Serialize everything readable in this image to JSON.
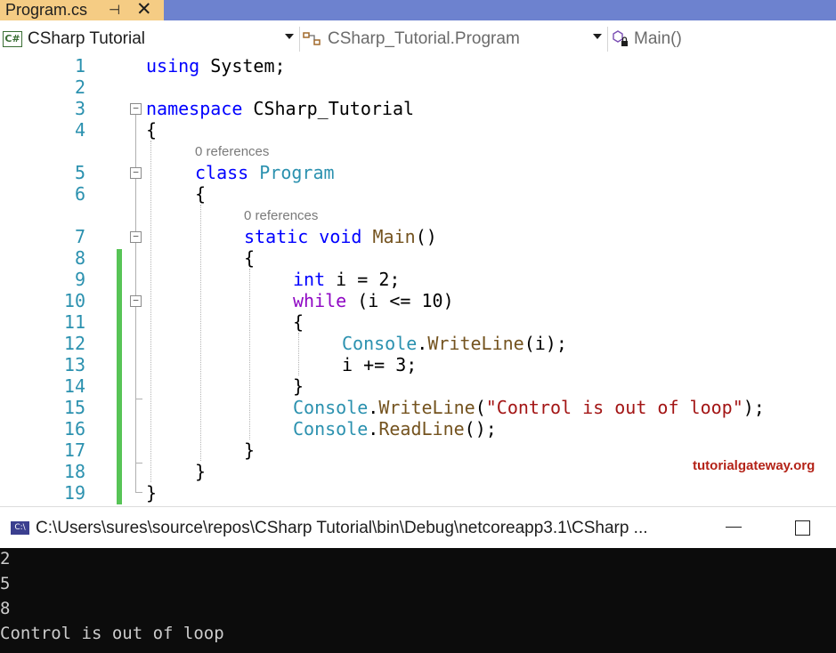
{
  "tab": {
    "title": "Program.cs",
    "pin": "⊣",
    "close": "✕"
  },
  "navbar": {
    "project": "CSharp Tutorial",
    "project_icon": "C#",
    "type": "CSharp_Tutorial.Program",
    "member": "Main()"
  },
  "editor": {
    "line_numbers": [
      "1",
      "2",
      "3",
      "4",
      "5",
      "6",
      "7",
      "8",
      "9",
      "10",
      "11",
      "12",
      "13",
      "14",
      "15",
      "16",
      "17",
      "18",
      "19"
    ],
    "references_label": "0 references",
    "tokens": {
      "using": "using",
      "system": " System;",
      "namespace": "namespace",
      "ns_name": " CSharp_Tutorial",
      "brace_open": "{",
      "brace_close": "}",
      "class": "class",
      "program": " Program",
      "static": "static",
      "void": " void",
      "main": " Main",
      "parens": "()",
      "int": "int",
      "int_rest": " i = 2;",
      "while": "while",
      "while_rest": " (i <= 10)",
      "console": "Console",
      "dot": ".",
      "writeline": "WriteLine",
      "writeline_arg": "(i);",
      "increment": "i += 3;",
      "paren_open": "(",
      "string_literal": "\"Control is out of loop\"",
      "stmt_end": ");",
      "readline": "ReadLine",
      "readline_rest": "();"
    },
    "watermark": "tutorialgateway.org"
  },
  "console": {
    "icon": "C:\\",
    "title": "C:\\Users\\sures\\source\\repos\\CSharp Tutorial\\bin\\Debug\\netcoreapp3.1\\CSharp ...",
    "output": [
      "2",
      "5",
      "8",
      "Control is out of loop"
    ]
  }
}
